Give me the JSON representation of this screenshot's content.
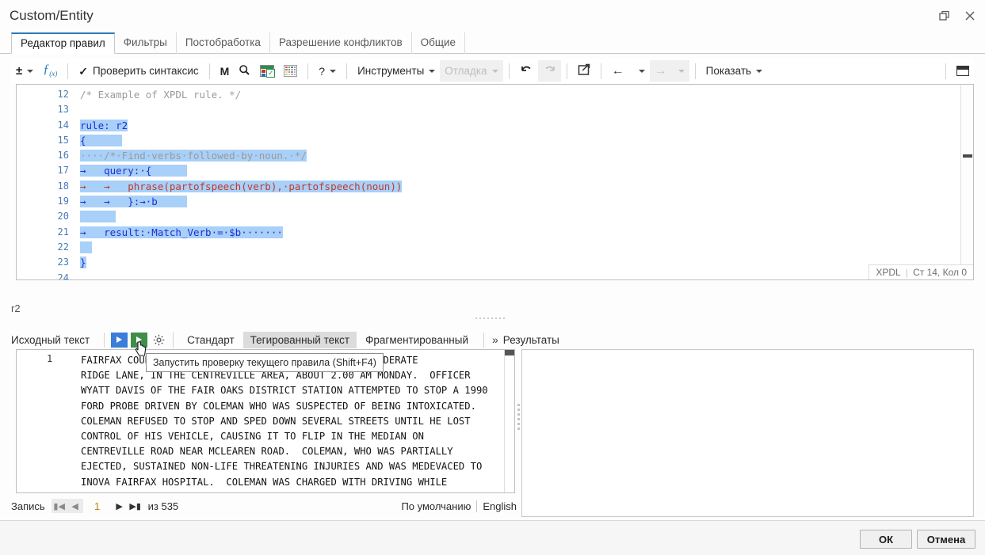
{
  "window": {
    "title": "Custom/Entity",
    "restore_icon": "restore-window-icon",
    "close_icon": "close-icon"
  },
  "tabs": [
    {
      "label": "Редактор правил",
      "active": true
    },
    {
      "label": "Фильтры",
      "active": false
    },
    {
      "label": "Постобработка",
      "active": false
    },
    {
      "label": "Разрешение конфликтов",
      "active": false
    },
    {
      "label": "Общие",
      "active": false
    }
  ],
  "toolbar": {
    "expand_collapse_icon": "plus-minus-icon",
    "function_icon": "fx-icon",
    "check_syntax_label": "Проверить синтаксис",
    "check_syntax_icon": "checkmark-icon",
    "macro_icon": "M",
    "search_icon": "search-icon",
    "spreadsheet_icon": "spreadsheet-check-icon",
    "palette_icon": "color-grid-icon",
    "help_icon": "?",
    "tools_label": "Инструменты",
    "debug_label": "Отладка",
    "undo_icon": "undo-icon",
    "redo_icon": "redo-icon",
    "open_external_icon": "open-external-icon",
    "back_icon": "back-arrow-icon",
    "forward_icon": "forward-arrow-icon",
    "show_label": "Показать",
    "layout_icon": "panel-layout-icon"
  },
  "editor": {
    "lines": [
      {
        "num": "12",
        "segments": [
          {
            "text": "/* Example of XPDL rule. */",
            "cls": "cm"
          }
        ]
      },
      {
        "num": "13",
        "segments": []
      },
      {
        "num": "14",
        "segments": [
          {
            "text": "rule: r2",
            "cls": "kw sel",
            "caret": true
          }
        ]
      },
      {
        "num": "15",
        "segments": [
          {
            "text": "{      ",
            "cls": "kw sel"
          }
        ]
      },
      {
        "num": "16",
        "segments": [
          {
            "text": "····/*·Find·verbs·followed·by·noun.·*/",
            "cls": "cm sel"
          }
        ]
      },
      {
        "num": "17",
        "segments": [
          {
            "text": "→   query:·{      ",
            "cls": "kw sel"
          }
        ]
      },
      {
        "num": "18",
        "segments": [
          {
            "text": "→   →   phrase(partofspeech(verb),·partofspeech(noun))",
            "cls": "fn sel"
          }
        ]
      },
      {
        "num": "19",
        "segments": [
          {
            "text": "→   →   }:→·b     ",
            "cls": "kw sel"
          }
        ]
      },
      {
        "num": "20",
        "segments": [
          {
            "text": "      ",
            "cls": "sel"
          }
        ]
      },
      {
        "num": "21",
        "segments": [
          {
            "text": "→   result:·Match_Verb·=·$b·······",
            "cls": "kw sel"
          }
        ]
      },
      {
        "num": "22",
        "segments": [
          {
            "text": "  ",
            "cls": "sel"
          }
        ]
      },
      {
        "num": "23",
        "segments": [
          {
            "text": "}",
            "cls": "kw sel"
          }
        ]
      },
      {
        "num": "24",
        "segments": []
      }
    ],
    "status_language": "XPDL",
    "status_position": "Ст 14, Кол 0"
  },
  "rule_name": "r2",
  "source_bar": {
    "source_text_label": "Исходный текст",
    "run_blue_icon": "play-icon",
    "run_green_icon": "play-rule-icon",
    "settings_icon": "gear-icon",
    "modes": [
      {
        "label": "Стандарт",
        "active": false
      },
      {
        "label": "Тегированный текст",
        "active": true
      },
      {
        "label": "Фрагментированный",
        "active": false
      }
    ],
    "expand_icon": "chevron-double-right-icon",
    "results_label": "Результаты"
  },
  "tooltip": {
    "text": "Запустить проверку текущего правила (Shift+F4)"
  },
  "source_text": {
    "line_number": "1",
    "body": "FAIRFAX COUNTY POLICE ARRESTED COLEMAN OF 6939 CONFEDERATE\nRIDGE LANE, IN THE CENTREVILLE AREA, ABOUT 2.00 AM MONDAY.  OFFICER\nWYATT DAVIS OF THE FAIR OAKS DISTRICT STATION ATTEMPTED TO STOP A 1990\nFORD PROBE DRIVEN BY COLEMAN WHO WAS SUSPECTED OF BEING INTOXICATED.\nCOLEMAN REFUSED TO STOP AND SPED DOWN SEVERAL STREETS UNTIL HE LOST\nCONTROL OF HIS VEHICLE, CAUSING IT TO FLIP IN THE MEDIAN ON\nCENTREVILLE ROAD NEAR MCLEAREN ROAD.  COLEMAN, WHO WAS PARTIALLY\nEJECTED, SUSTAINED NON-LIFE THREATENING INJURIES AND WAS MEDEVACED TO\nINOVA FAIRFAX HOSPITAL.  COLEMAN WAS CHARGED WITH DRIVING WHILE\nINTOXICATED AND SPEED TO ELUDE."
  },
  "record_bar": {
    "label": "Запись",
    "first_icon": "first-record-icon",
    "prev_icon": "previous-record-icon",
    "current": "1",
    "next_icon": "next-record-icon",
    "last_icon": "last-record-icon",
    "of_label": "из 535",
    "profile": "По умолчанию",
    "language": "English"
  },
  "footer": {
    "ok_label": "ОК",
    "cancel_label": "Отмена"
  },
  "colors": {
    "accent": "#2b7bb9",
    "selection": "#a8d0f8",
    "run_blue": "#3b7dd8",
    "run_green": "#3f8f4a"
  }
}
